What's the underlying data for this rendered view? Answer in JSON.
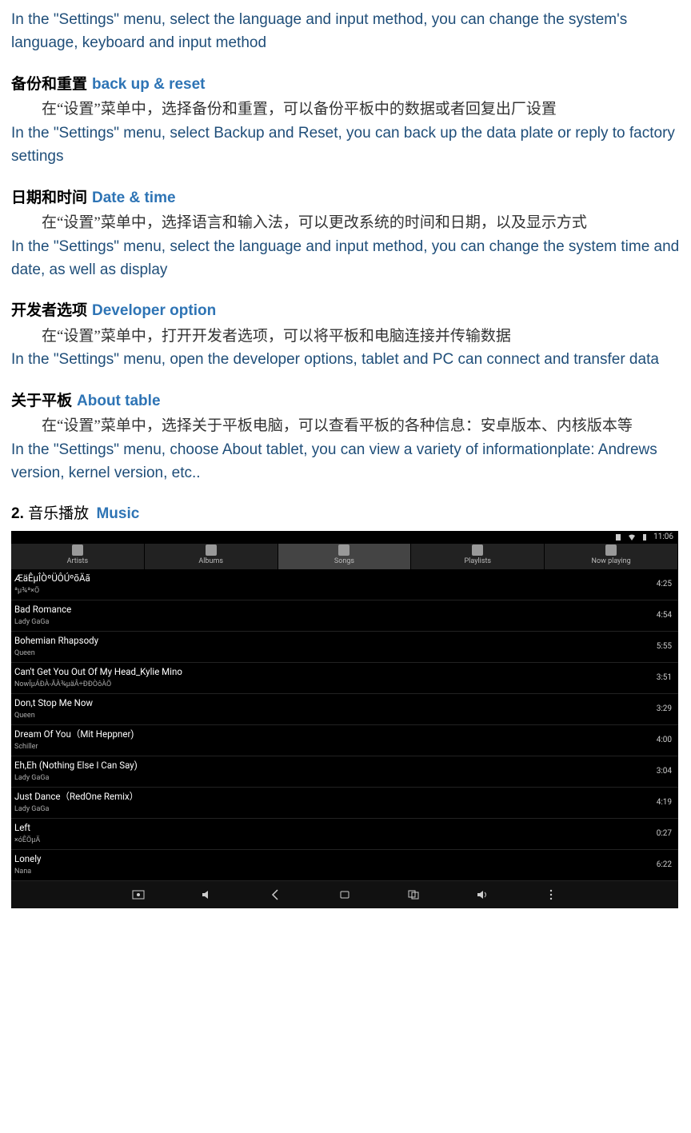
{
  "intro_en": "In the \"Settings\" menu, select the language and input method, you can change the system's language, keyboard and input method",
  "sections": [
    {
      "zh_title": "备份和重置",
      "en_title": "back up & reset",
      "zh_body": "在“设置”菜单中，选择备份和重置，可以备份平板中的数据或者回复出厂设置",
      "en_body": "In the \"Settings\" menu, select Backup and Reset, you can back up the data plate or reply to factory settings"
    },
    {
      "zh_title": "日期和时间",
      "en_title": "Date & time",
      "zh_body": "在“设置”菜单中，选择语言和输入法，可以更改系统的时间和日期，以及显示方式",
      "en_body": "In the \"Settings\" menu, select the language and input method, you can change the system time and date, as well as display"
    },
    {
      "zh_title": "开发者选项",
      "en_title": "Developer option",
      "zh_body": "在“设置”菜单中，打开开发者选项，可以将平板和电脑连接并传输数据",
      "en_body": "In the \"Settings\" menu, open the developer options, tablet and PC can connect and transfer data"
    },
    {
      "zh_title": "关于平板",
      "en_title": "About table",
      "zh_body": "在“设置”菜单中，选择关于平板电脑，可以查看平板的各种信息：安卓版本、内核版本等",
      "en_body": "In the \"Settings\" menu, choose About tablet, you can view a variety of informationplate: Andrews version, kernel version, etc.."
    }
  ],
  "music_heading": {
    "num": "2.",
    "zh": "音乐播放",
    "en": "Music"
  },
  "statusbar": {
    "time": "11:06"
  },
  "tabs": [
    {
      "label": "Artists",
      "active": false
    },
    {
      "label": "Albums",
      "active": false
    },
    {
      "label": "Songs",
      "active": true
    },
    {
      "label": "Playlists",
      "active": false
    },
    {
      "label": "Now playing",
      "active": false
    }
  ],
  "songs": [
    {
      "title": "ÆäÊµÎÒºÜÔÚºõÄã",
      "artist": "ªµ¾ª×Ö",
      "duration": "4:25"
    },
    {
      "title": "Bad Romance",
      "artist": "Lady GaGa",
      "duration": "4:54"
    },
    {
      "title": "Bohemian Rhapsody",
      "artist": "Queen",
      "duration": "5:55"
    },
    {
      "title": "Can't Get You Out Of My Head_Kylie Mino",
      "artist": "NowÏµÁÐÀ-ÃÀ¾µäÂ÷ÐÐÒôÀÖ",
      "duration": "3:51"
    },
    {
      "title": "Don,t Stop Me Now",
      "artist": "Queen",
      "duration": "3:29"
    },
    {
      "title": "Dream Of You（Mit Heppner)",
      "artist": "Schiller",
      "duration": "4:00"
    },
    {
      "title": "Eh,Eh (Nothing Else I Can Say)",
      "artist": "Lady GaGa",
      "duration": "3:04"
    },
    {
      "title": "Just Dance（RedOne Remix）",
      "artist": "Lady GaGa",
      "duration": "4:19"
    },
    {
      "title": "Left",
      "artist": "×óÊÖµÄ",
      "duration": "0:27"
    },
    {
      "title": "Lonely",
      "artist": "Nana",
      "duration": "6:22"
    }
  ],
  "navbuttons": [
    "screenshot",
    "volume-down",
    "back",
    "home",
    "recent",
    "volume-up",
    "menu"
  ]
}
